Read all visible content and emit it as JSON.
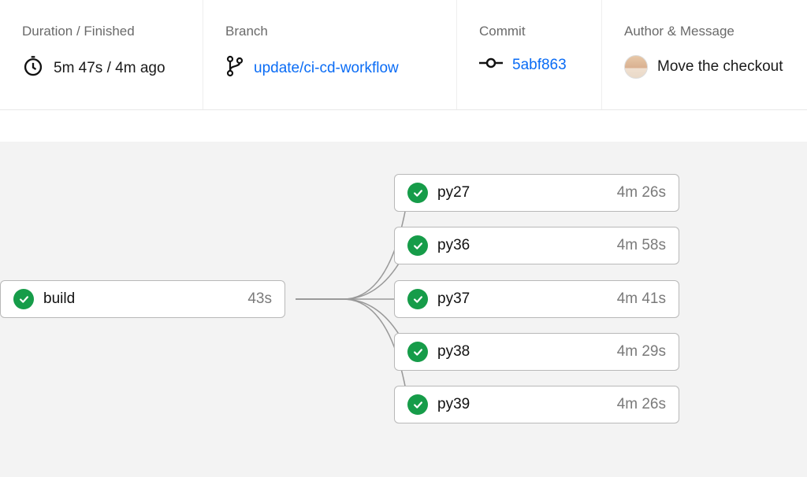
{
  "header": {
    "duration": {
      "label": "Duration / Finished",
      "value": "5m 47s / 4m ago"
    },
    "branch": {
      "label": "Branch",
      "value": "update/ci-cd-workflow"
    },
    "commit": {
      "label": "Commit",
      "value": "5abf863"
    },
    "author": {
      "label": "Author & Message",
      "message": "Move the checkout "
    }
  },
  "workflow": {
    "root": {
      "name": "build",
      "time": "43s"
    },
    "jobs": [
      {
        "name": "py27",
        "time": "4m 26s"
      },
      {
        "name": "py36",
        "time": "4m 58s"
      },
      {
        "name": "py37",
        "time": "4m 41s"
      },
      {
        "name": "py38",
        "time": "4m 29s"
      },
      {
        "name": "py39",
        "time": "4m 26s"
      }
    ]
  }
}
